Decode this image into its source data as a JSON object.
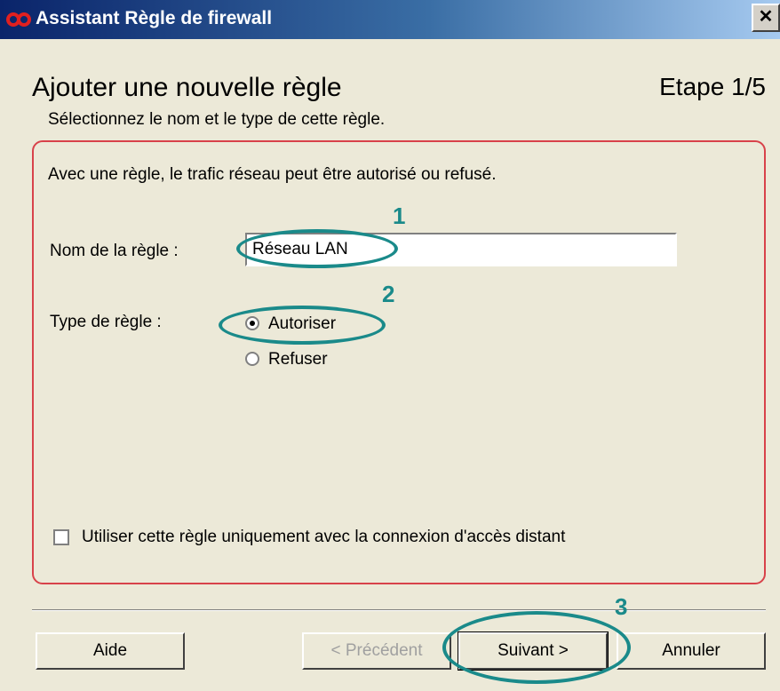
{
  "window": {
    "title": "Assistant Règle de firewall",
    "close_glyph": "✕"
  },
  "header": {
    "title": "Ajouter une nouvelle règle",
    "step": "Etape 1/5",
    "subtitle": "Sélectionnez le nom et le type de cette règle."
  },
  "form": {
    "description": "Avec une règle, le trafic réseau peut être autorisé ou refusé.",
    "name_label": "Nom de la règle :",
    "name_value": "Réseau LAN",
    "type_label": "Type de règle :",
    "options": [
      {
        "label": "Autoriser",
        "checked": true
      },
      {
        "label": "Refuser",
        "checked": false
      }
    ],
    "checkbox_label": "Utiliser cette règle uniquement avec la connexion d'accès distant",
    "checkbox_checked": false
  },
  "buttons": {
    "help": "Aide",
    "previous": "< Précédent",
    "next": "Suivant >",
    "cancel": "Annuler"
  },
  "annotations": [
    "1",
    "2",
    "3"
  ],
  "colors": {
    "annotation": "#1a8a8a",
    "group_border": "#d8424a"
  }
}
